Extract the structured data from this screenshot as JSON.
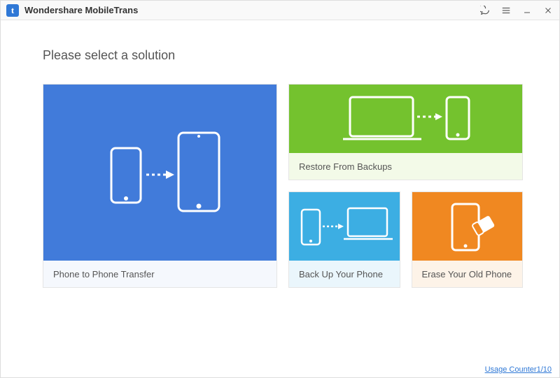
{
  "app": {
    "title_prefix": "Wondershare ",
    "title_product": "MobileTrans"
  },
  "heading": "Please select a solution",
  "cards": {
    "transfer": {
      "label": "Phone to Phone Transfer"
    },
    "restore": {
      "label": "Restore From Backups"
    },
    "backup": {
      "label": "Back Up Your Phone"
    },
    "erase": {
      "label": "Erase Your Old Phone"
    }
  },
  "footer": {
    "usage_label": "Usage Counter",
    "usage_count": "1/10"
  },
  "colors": {
    "blue": "#417BDA",
    "green": "#74C22E",
    "cyan": "#3CAEE3",
    "orange": "#F08821"
  }
}
